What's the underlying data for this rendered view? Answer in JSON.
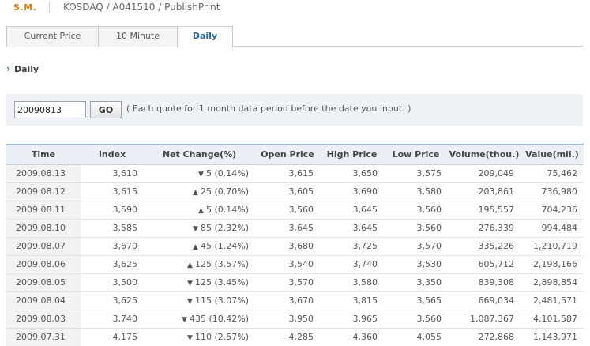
{
  "header": {
    "brand": "S.M.",
    "breadcrumb": "KOSDAQ / A041510 / PublishPrint"
  },
  "tabs": [
    {
      "label": "Current Price",
      "active": false
    },
    {
      "label": "10 Minute",
      "active": false
    },
    {
      "label": "Daily",
      "active": true
    }
  ],
  "section": {
    "title": "Daily"
  },
  "search": {
    "date_value": "20090813",
    "go_label": "GO",
    "hint": "( Each quote for 1 month data period before the date you input. )"
  },
  "table": {
    "columns": [
      "Time",
      "Index",
      "Net Change(%)",
      "Open Price",
      "High Price",
      "Low Price",
      "Volume(thou.)",
      "Value(mil.)"
    ],
    "rows": [
      {
        "time": "2009.08.13",
        "index": "3,610",
        "dir": "down",
        "change": "5 (0.14%)",
        "open": "3,615",
        "high": "3,650",
        "low": "3,575",
        "volume": "209,049",
        "value": "75,462",
        "c": [
          "down",
          "flat",
          "up",
          "down"
        ]
      },
      {
        "time": "2009.08.12",
        "index": "3,615",
        "dir": "up",
        "change": "25 (0.70%)",
        "open": "3,605",
        "high": "3,690",
        "low": "3,580",
        "volume": "203,861",
        "value": "736,980",
        "c": [
          "up",
          "up",
          "up",
          "down"
        ]
      },
      {
        "time": "2009.08.11",
        "index": "3,590",
        "dir": "up",
        "change": "5 (0.14%)",
        "open": "3,560",
        "high": "3,645",
        "low": "3,560",
        "volume": "195,557",
        "value": "704,236",
        "c": [
          "up",
          "down",
          "up",
          "down"
        ]
      },
      {
        "time": "2009.08.10",
        "index": "3,585",
        "dir": "down",
        "change": "85 (2.32%)",
        "open": "3,645",
        "high": "3,645",
        "low": "3,560",
        "volume": "276,339",
        "value": "994,484",
        "c": [
          "down",
          "down",
          "down",
          "down"
        ]
      },
      {
        "time": "2009.08.07",
        "index": "3,670",
        "dir": "up",
        "change": "45 (1.24%)",
        "open": "3,680",
        "high": "3,725",
        "low": "3,570",
        "volume": "335,226",
        "value": "1,210,719",
        "c": [
          "up",
          "up",
          "up",
          "down"
        ]
      },
      {
        "time": "2009.08.06",
        "index": "3,625",
        "dir": "up",
        "change": "125 (3.57%)",
        "open": "3,540",
        "high": "3,740",
        "low": "3,530",
        "volume": "605,712",
        "value": "2,198,166",
        "c": [
          "up",
          "up",
          "up",
          "up"
        ]
      },
      {
        "time": "2009.08.05",
        "index": "3,500",
        "dir": "down",
        "change": "125 (3.45%)",
        "open": "3,570",
        "high": "3,580",
        "low": "3,350",
        "volume": "839,308",
        "value": "2,898,854",
        "c": [
          "down",
          "down",
          "down",
          "down"
        ]
      },
      {
        "time": "2009.08.04",
        "index": "3,625",
        "dir": "down",
        "change": "115 (3.07%)",
        "open": "3,670",
        "high": "3,815",
        "low": "3,565",
        "volume": "669,034",
        "value": "2,481,571",
        "c": [
          "down",
          "down",
          "up",
          "down"
        ]
      },
      {
        "time": "2009.08.03",
        "index": "3,740",
        "dir": "down",
        "change": "435 (10.42%)",
        "open": "3,950",
        "high": "3,965",
        "low": "3,560",
        "volume": "1,087,367",
        "value": "4,101,587",
        "c": [
          "down",
          "down",
          "down",
          "down"
        ]
      },
      {
        "time": "2009.07.31",
        "index": "4,175",
        "dir": "down",
        "change": "110 (2.57%)",
        "open": "4,285",
        "high": "4,360",
        "low": "4,055",
        "volume": "272,868",
        "value": "1,143,971",
        "c": [
          "down",
          "flat",
          "up",
          "down"
        ]
      }
    ]
  },
  "colors": {
    "up": "#1f8a1f",
    "down": "#d01717",
    "brand": "#e07a14",
    "accent": "#2a6aa8"
  }
}
